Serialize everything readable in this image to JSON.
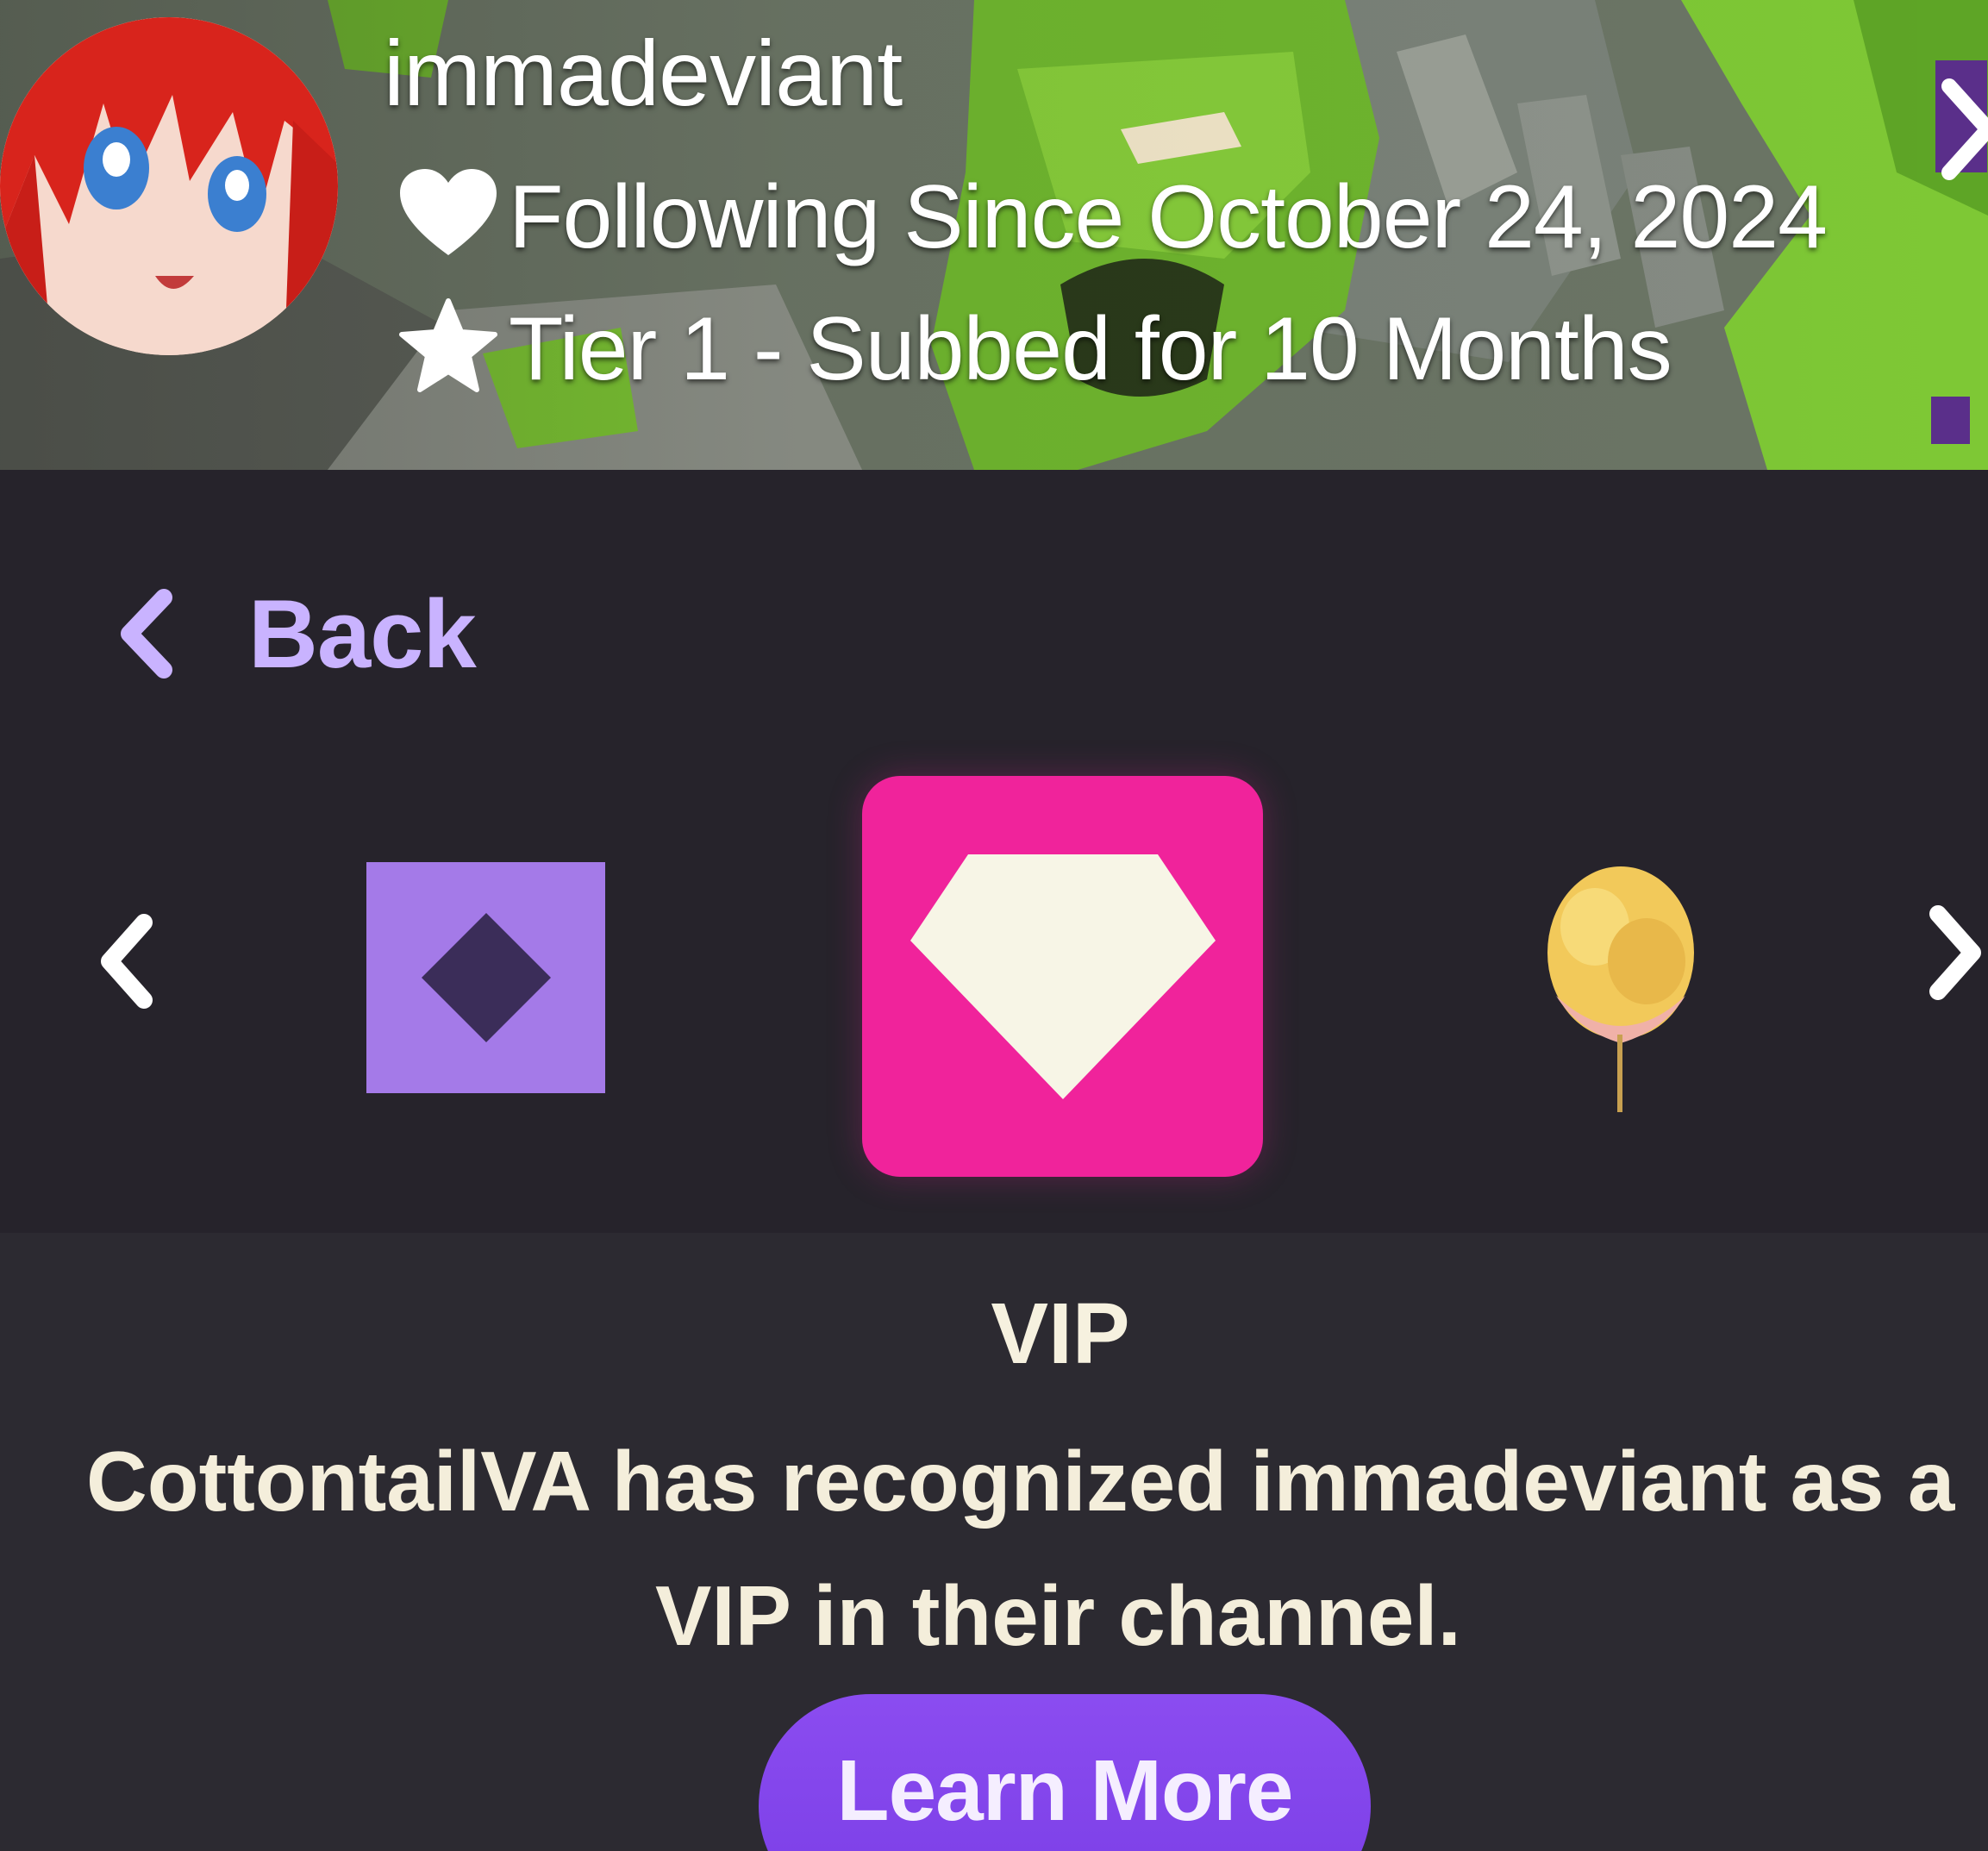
{
  "profile": {
    "username": "immadeviant",
    "following_text": "Following Since October 24, 2024",
    "subscription_text": "Tier 1 - Subbed for 10 Months",
    "following_icon": "heart-icon",
    "subscription_icon": "star-icon"
  },
  "nav": {
    "back_label": "Back"
  },
  "badges": [
    {
      "name": "vip-outline-badge",
      "color": "#a47ae8"
    },
    {
      "name": "vip-badge",
      "color": "#f0239b",
      "selected": true
    },
    {
      "name": "cotton-candy-badge",
      "color": "#f2c95a"
    }
  ],
  "detail": {
    "title": "VIP",
    "description_line1": "CottontailVA has recognized immadeviant as a",
    "description_line2": "VIP in their channel.",
    "learn_more_label": "Learn More"
  },
  "colors": {
    "accent": "#9147ff",
    "back_link": "#c9b3ff",
    "panel_bg": "#26232b"
  }
}
